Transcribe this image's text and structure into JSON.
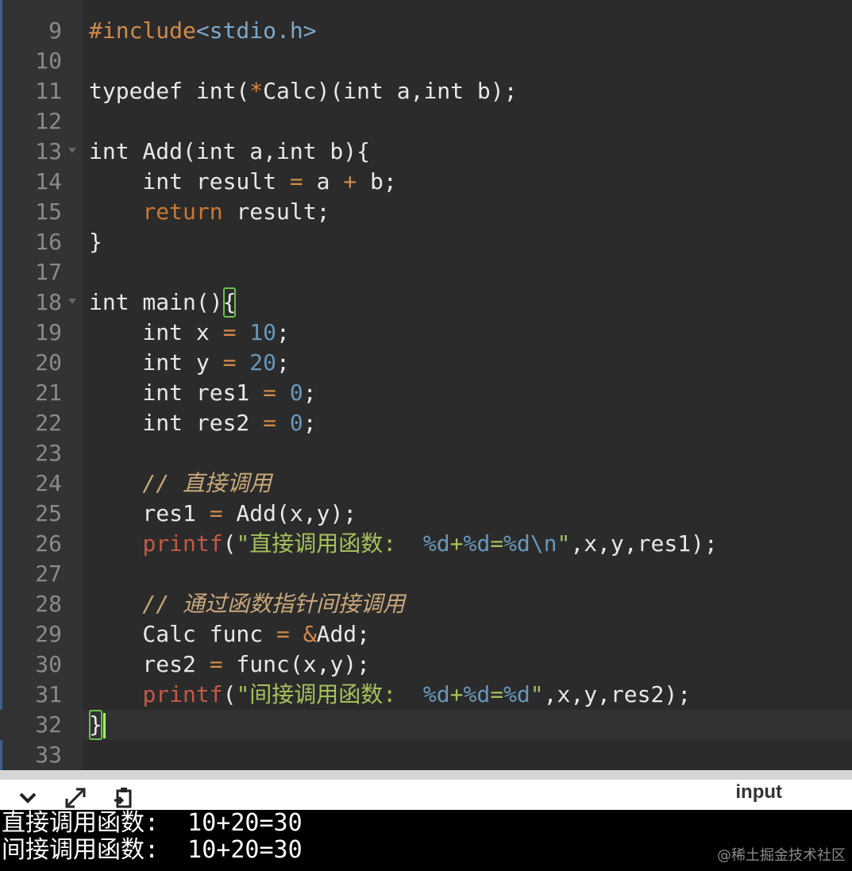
{
  "editor": {
    "line_numbers": [
      "9",
      "10",
      "11",
      "12",
      "13",
      "14",
      "15",
      "16",
      "17",
      "18",
      "19",
      "20",
      "21",
      "22",
      "23",
      "24",
      "25",
      "26",
      "27",
      "28",
      "29",
      "30",
      "31",
      "32",
      "33"
    ],
    "lines": {
      "l9_a": "#include",
      "l9_b": "<stdio.h>",
      "l11_a": "typedef int(",
      "l11_b": "*",
      "l11_c": "Calc)(int a,int b);",
      "l13": "int Add(int a,int b){",
      "l14_a": "    int result ",
      "l14_b": "=",
      "l14_c": " a ",
      "l14_d": "+",
      "l14_e": " b;",
      "l15_a": "    ",
      "l15_b": "return",
      "l15_c": " result;",
      "l16": "}",
      "l18_a": "int main()",
      "l18_b": "{",
      "l19_a": "    int x ",
      "l19_b": "=",
      "l19_c": " ",
      "l19_d": "10",
      "l19_e": ";",
      "l20_a": "    int y ",
      "l20_b": "=",
      "l20_c": " ",
      "l20_d": "20",
      "l20_e": ";",
      "l21_a": "    int res1 ",
      "l21_b": "=",
      "l21_c": " ",
      "l21_d": "0",
      "l21_e": ";",
      "l22_a": "    int res2 ",
      "l22_b": "=",
      "l22_c": " ",
      "l22_d": "0",
      "l22_e": ";",
      "l24": "    // 直接调用",
      "l25_a": "    res1 ",
      "l25_b": "=",
      "l25_c": " Add(x,y);",
      "l26_a": "    ",
      "l26_b": "printf",
      "l26_c": "(",
      "l26_d": "\"直接调用函数:  ",
      "l26_e": "%d",
      "l26_f": "+",
      "l26_g": "%d",
      "l26_h": "=",
      "l26_i": "%d\\n",
      "l26_j": "\"",
      "l26_k": ",x,y,res1);",
      "l28": "    // 通过函数指针间接调用",
      "l29_a": "    Calc func ",
      "l29_b": "=",
      "l29_c": " ",
      "l29_d": "&",
      "l29_e": "Add;",
      "l30_a": "    res2 ",
      "l30_b": "=",
      "l30_c": " func(x,y);",
      "l31_a": "    ",
      "l31_b": "printf",
      "l31_c": "(",
      "l31_d": "\"间接调用函数:  ",
      "l31_e": "%d",
      "l31_f": "+",
      "l31_g": "%d",
      "l31_h": "=",
      "l31_i": "%d",
      "l31_j": "\"",
      "l31_k": ",x,y,res2);",
      "l32": "}"
    }
  },
  "toolbar": {
    "collapse_icon": "chevron-down-icon",
    "expand_icon": "expand-arrows-icon",
    "clear_icon": "clipboard-icon",
    "input_label": "input"
  },
  "console": {
    "lines": [
      "直接调用函数:  10+20=30",
      "间接调用函数:  10+20=30"
    ]
  },
  "watermark": "@稀土掘金技术社区"
}
